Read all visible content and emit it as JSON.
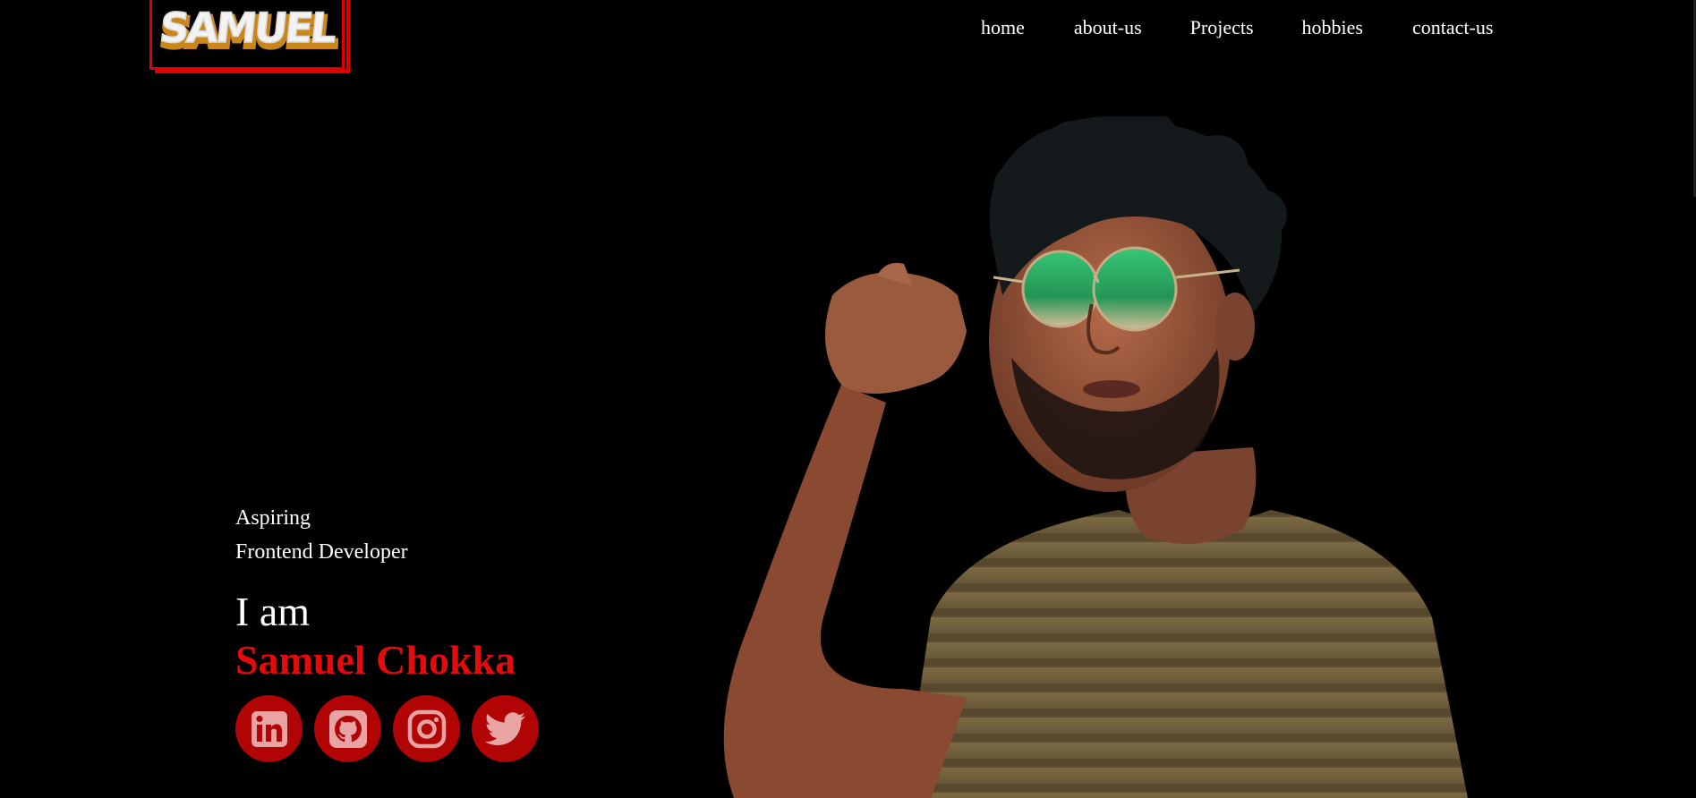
{
  "logo": {
    "text": "SAMUEL",
    "border_color": "#e00000",
    "fill_color": "#ffffff",
    "shadow_color": "#e5a21a"
  },
  "nav": {
    "items": [
      {
        "label": "home"
      },
      {
        "label": "about-us"
      },
      {
        "label": "Projects"
      },
      {
        "label": "hobbies"
      },
      {
        "label": "contact-us"
      }
    ]
  },
  "hero": {
    "tagline_line1": "Aspiring",
    "tagline_line2": "Frontend Developer",
    "intro": "I am",
    "name": "Samuel Chokka",
    "name_color": "#e30b0b"
  },
  "socials": [
    {
      "icon": "linkedin-icon"
    },
    {
      "icon": "github-icon"
    },
    {
      "icon": "instagram-icon"
    },
    {
      "icon": "twitter-icon"
    }
  ],
  "colors": {
    "background": "#000000",
    "accent": "#e30b0b",
    "social_bg": "#b10404"
  }
}
